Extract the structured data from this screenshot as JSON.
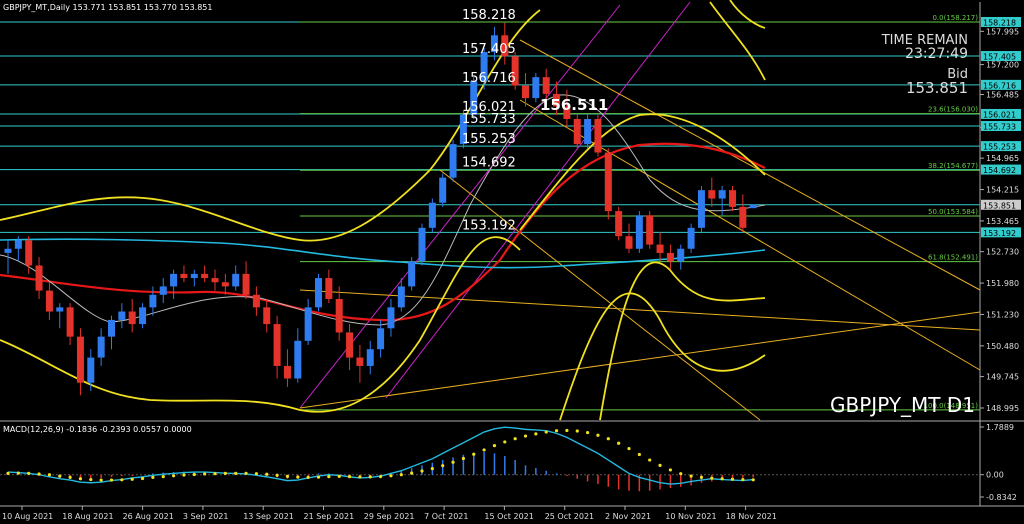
{
  "header": {
    "symbol_line": "GBPJPY_MT,Daily  153.771 153.851 153.770 153.851",
    "macd_line": "MACD(12,26,9) -0.1836 -0.2393 0.0557 0.0000"
  },
  "overlay": {
    "time_remain_label": "TIME REMAIN",
    "time_remain_value": "23:27:49",
    "bid_label": "Bid",
    "bid_value": "153.851",
    "watermark": "GBPJPY_MT D1",
    "highlight_price": "156.511"
  },
  "colors": {
    "bull": "#2f7cf0",
    "bear": "#e4332a",
    "level_line": "#33cccc",
    "fib_line": "#66cc44",
    "yellow": "#f0e020",
    "red_ma": "#e81818",
    "cyan_ma": "#22b8e0",
    "magenta": "#cc22cc",
    "channel": "#e8b020"
  },
  "chart_data": [
    {
      "type": "candlestick",
      "title": "GBPJPY_MT D1",
      "ylim": [
        148.75,
        158.45
      ],
      "x_dates": [
        "10 Aug 2021",
        "18 Aug 2021",
        "26 Aug 2021",
        "3 Sep 2021",
        "13 Sep 2021",
        "21 Sep 2021",
        "29 Sep 2021",
        "7 Oct 2021",
        "15 Oct 2021",
        "25 Oct 2021",
        "2 Nov 2021",
        "10 Nov 2021",
        "18 Nov 2021"
      ],
      "y_ticks": [
        "157.995",
        "157.200",
        "156.485",
        "155.7",
        "154.965",
        "154.215",
        "153.465",
        "152.730",
        "151.980",
        "151.230",
        "150.480",
        "149.745",
        "148.995"
      ],
      "candles_ohlc": [
        [
          152.7,
          153.0,
          152.2,
          152.8
        ],
        [
          152.8,
          153.1,
          152.5,
          153.0
        ],
        [
          153.0,
          153.1,
          152.2,
          152.4
        ],
        [
          152.4,
          152.6,
          151.6,
          151.8
        ],
        [
          151.8,
          152.0,
          151.1,
          151.3
        ],
        [
          151.3,
          151.5,
          150.9,
          151.4
        ],
        [
          151.4,
          151.5,
          150.5,
          150.7
        ],
        [
          150.7,
          150.9,
          149.3,
          149.6
        ],
        [
          149.6,
          150.4,
          149.4,
          150.2
        ],
        [
          150.2,
          150.9,
          150.0,
          150.7
        ],
        [
          150.7,
          151.2,
          150.4,
          151.1
        ],
        [
          151.1,
          151.5,
          150.9,
          151.3
        ],
        [
          151.3,
          151.6,
          150.8,
          151.0
        ],
        [
          151.0,
          151.5,
          150.9,
          151.4
        ],
        [
          151.4,
          151.9,
          151.2,
          151.7
        ],
        [
          151.7,
          152.1,
          151.5,
          151.9
        ],
        [
          151.9,
          152.3,
          151.6,
          152.2
        ],
        [
          152.2,
          152.4,
          152.0,
          152.1
        ],
        [
          152.1,
          152.3,
          151.9,
          152.2
        ],
        [
          152.2,
          152.4,
          152.0,
          152.1
        ],
        [
          152.1,
          152.3,
          151.8,
          152.0
        ],
        [
          152.0,
          152.2,
          151.7,
          151.9
        ],
        [
          151.9,
          152.4,
          151.8,
          152.2
        ],
        [
          152.2,
          152.5,
          151.6,
          151.7
        ],
        [
          151.7,
          151.9,
          151.2,
          151.4
        ],
        [
          151.4,
          151.6,
          150.8,
          151.0
        ],
        [
          151.0,
          151.2,
          149.7,
          150.0
        ],
        [
          150.0,
          150.4,
          149.5,
          149.7
        ],
        [
          149.7,
          150.9,
          149.6,
          150.6
        ],
        [
          150.6,
          151.6,
          150.5,
          151.4
        ],
        [
          151.4,
          152.2,
          151.3,
          152.1
        ],
        [
          152.1,
          152.3,
          151.5,
          151.6
        ],
        [
          151.6,
          151.9,
          150.6,
          150.8
        ],
        [
          150.8,
          151.0,
          149.9,
          150.2
        ],
        [
          150.2,
          150.5,
          149.6,
          150.0
        ],
        [
          150.0,
          150.6,
          149.8,
          150.4
        ],
        [
          150.4,
          151.1,
          150.2,
          150.9
        ],
        [
          150.9,
          151.6,
          150.7,
          151.4
        ],
        [
          151.4,
          152.1,
          151.3,
          151.9
        ],
        [
          151.9,
          152.6,
          151.8,
          152.5
        ],
        [
          152.5,
          153.4,
          152.4,
          153.3
        ],
        [
          153.3,
          154.0,
          153.2,
          153.9
        ],
        [
          153.9,
          154.6,
          153.8,
          154.5
        ],
        [
          154.5,
          155.4,
          154.4,
          155.3
        ],
        [
          155.3,
          156.1,
          155.2,
          156.0
        ],
        [
          156.0,
          156.9,
          155.9,
          156.8
        ],
        [
          156.8,
          157.6,
          156.6,
          157.5
        ],
        [
          157.5,
          158.1,
          157.3,
          157.9
        ],
        [
          157.9,
          158.2,
          157.2,
          157.4
        ],
        [
          157.4,
          157.5,
          156.6,
          156.7
        ],
        [
          156.7,
          157.0,
          156.2,
          156.4
        ],
        [
          156.4,
          157.0,
          156.3,
          156.9
        ],
        [
          156.9,
          157.1,
          156.3,
          156.5
        ],
        [
          156.5,
          156.8,
          156.0,
          156.2
        ],
        [
          156.2,
          156.6,
          155.7,
          155.9
        ],
        [
          155.9,
          156.0,
          155.2,
          155.3
        ],
        [
          155.3,
          156.0,
          155.2,
          155.9
        ],
        [
          155.9,
          156.0,
          155.0,
          155.1
        ],
        [
          155.1,
          155.2,
          153.5,
          153.7
        ],
        [
          153.7,
          153.8,
          153.0,
          153.1
        ],
        [
          153.1,
          153.4,
          152.7,
          152.8
        ],
        [
          152.8,
          153.7,
          152.7,
          153.6
        ],
        [
          153.6,
          153.7,
          152.8,
          152.9
        ],
        [
          152.9,
          153.2,
          152.5,
          152.7
        ],
        [
          152.7,
          152.9,
          152.3,
          152.5
        ],
        [
          152.5,
          152.9,
          152.3,
          152.8
        ],
        [
          152.8,
          153.4,
          152.7,
          153.3
        ],
        [
          153.3,
          154.3,
          153.2,
          154.2
        ],
        [
          154.2,
          154.5,
          153.8,
          154.0
        ],
        [
          154.0,
          154.3,
          153.6,
          154.2
        ],
        [
          154.2,
          154.3,
          153.7,
          153.8
        ],
        [
          153.8,
          154.1,
          153.2,
          153.3
        ],
        [
          153.77,
          153.85,
          153.77,
          153.85
        ]
      ],
      "price_levels": [
        158.218,
        157.405,
        156.716,
        156.021,
        155.733,
        155.253,
        154.692,
        153.851,
        153.192
      ],
      "price_labels_left": [
        "158.218",
        "157.405",
        "156.716",
        "156.021",
        "155.733",
        "155.253",
        "154.692",
        "153.192"
      ],
      "fibonacci": [
        {
          "label": "0.0(158.217)",
          "price": 158.217
        },
        {
          "label": "23.6(156.030)",
          "price": 156.03
        },
        {
          "label": "38.2(154.677)",
          "price": 154.677
        },
        {
          "label": "50.0(153.584)",
          "price": 153.584
        },
        {
          "label": "61.8(152.491)",
          "price": 152.491
        },
        {
          "label": "100.0(148.951)",
          "price": 148.951
        }
      ]
    },
    {
      "type": "bar",
      "title": "MACD(12,26,9)",
      "ylim": [
        -0.8342,
        1.7889
      ],
      "y_ticks": [
        "1.7889",
        "0.00",
        "-0.8342"
      ],
      "histogram": [
        0.05,
        0.04,
        0.0,
        -0.05,
        -0.1,
        -0.12,
        -0.15,
        -0.18,
        -0.15,
        -0.12,
        -0.08,
        -0.05,
        -0.04,
        0.0,
        0.05,
        0.08,
        0.1,
        0.12,
        0.12,
        0.11,
        0.1,
        0.08,
        0.07,
        0.05,
        0.0,
        -0.05,
        -0.1,
        -0.15,
        -0.12,
        -0.05,
        0.05,
        0.05,
        0.0,
        -0.05,
        -0.08,
        -0.05,
        0.0,
        0.08,
        0.15,
        0.25,
        0.35,
        0.45,
        0.55,
        0.65,
        0.75,
        0.82,
        0.85,
        0.8,
        0.7,
        0.55,
        0.35,
        0.25,
        0.15,
        0.05,
        -0.05,
        -0.15,
        -0.25,
        -0.35,
        -0.45,
        -0.55,
        -0.6,
        -0.62,
        -0.6,
        -0.55,
        -0.5,
        -0.45,
        -0.4,
        -0.3,
        -0.25,
        -0.2,
        -0.15,
        -0.12,
        -0.1
      ],
      "macd_line": [
        0.1,
        0.08,
        0.05,
        0.0,
        -0.08,
        -0.15,
        -0.2,
        -0.28,
        -0.3,
        -0.28,
        -0.22,
        -0.18,
        -0.12,
        -0.08,
        -0.02,
        0.02,
        0.05,
        0.08,
        0.1,
        0.1,
        0.08,
        0.06,
        0.05,
        0.03,
        -0.02,
        -0.08,
        -0.15,
        -0.22,
        -0.2,
        -0.12,
        -0.05,
        0.0,
        -0.02,
        -0.08,
        -0.12,
        -0.1,
        -0.05,
        0.05,
        0.15,
        0.3,
        0.45,
        0.6,
        0.8,
        1.0,
        1.2,
        1.4,
        1.6,
        1.72,
        1.78,
        1.75,
        1.7,
        1.68,
        1.65,
        1.55,
        1.4,
        1.2,
        1.0,
        0.8,
        0.55,
        0.3,
        0.05,
        -0.1,
        -0.2,
        -0.3,
        -0.35,
        -0.32,
        -0.25,
        -0.2,
        -0.15,
        -0.18,
        -0.2,
        -0.22,
        -0.18
      ],
      "signal_dots": [
        0.05,
        0.06,
        0.05,
        0.03,
        0.0,
        -0.05,
        -0.1,
        -0.15,
        -0.18,
        -0.2,
        -0.2,
        -0.19,
        -0.17,
        -0.14,
        -0.1,
        -0.07,
        -0.04,
        -0.01,
        0.01,
        0.03,
        0.04,
        0.05,
        0.05,
        0.05,
        0.04,
        0.02,
        -0.02,
        -0.06,
        -0.09,
        -0.1,
        -0.09,
        -0.07,
        -0.06,
        -0.07,
        -0.08,
        -0.08,
        -0.07,
        -0.04,
        0.0,
        0.06,
        0.14,
        0.23,
        0.34,
        0.47,
        0.61,
        0.77,
        0.93,
        1.09,
        1.23,
        1.35,
        1.45,
        1.53,
        1.6,
        1.65,
        1.66,
        1.64,
        1.58,
        1.48,
        1.35,
        1.18,
        0.98,
        0.76,
        0.55,
        0.35,
        0.18,
        0.04,
        -0.05,
        -0.1,
        -0.13,
        -0.15,
        -0.17,
        -0.18,
        -0.19
      ]
    }
  ]
}
